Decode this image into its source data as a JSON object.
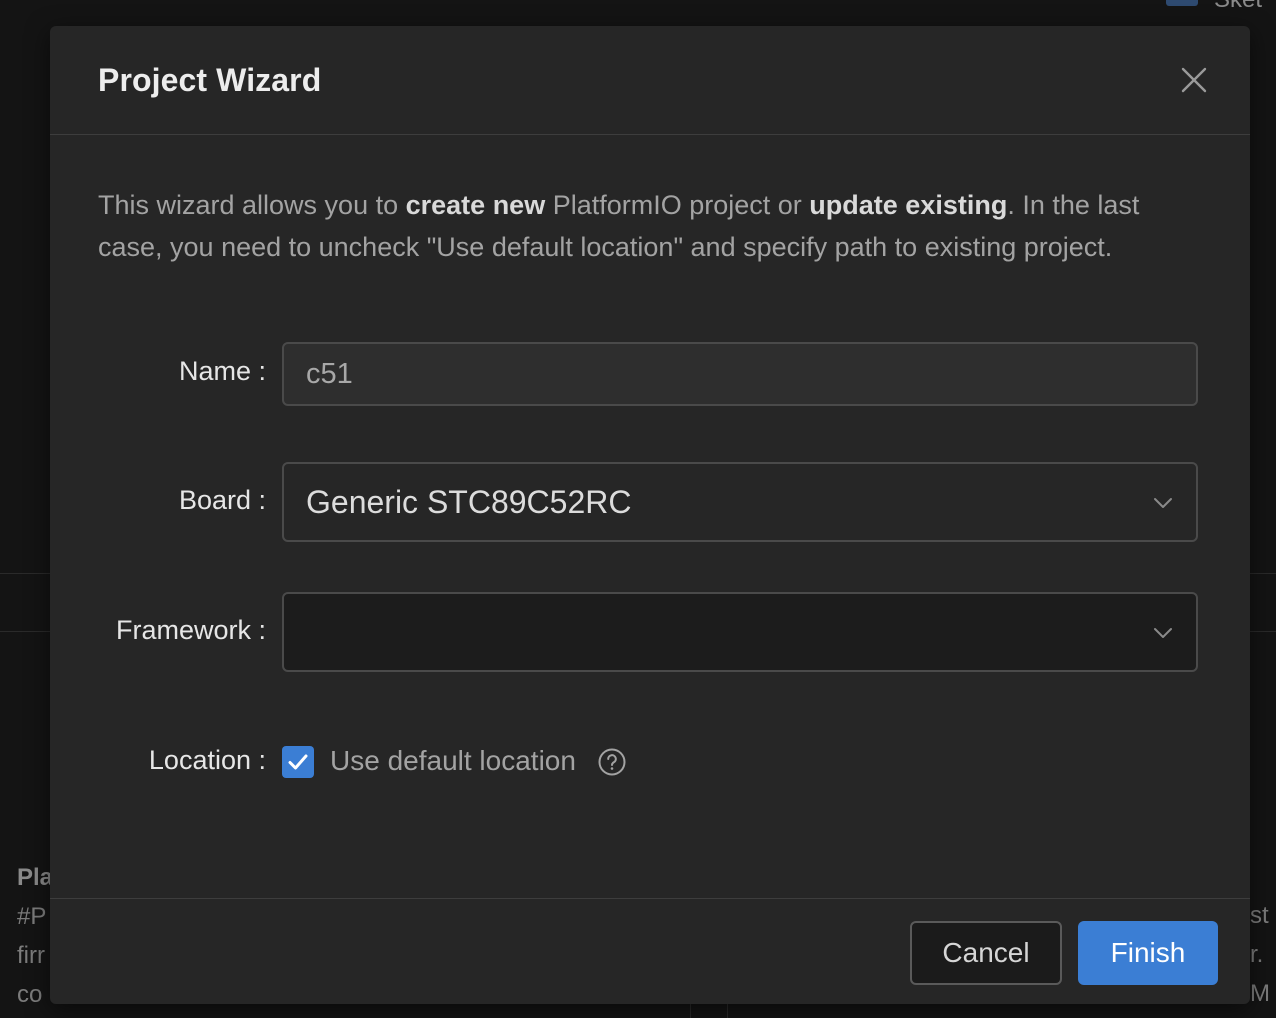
{
  "background": {
    "top_right_text": "Sket",
    "left_panel_lines": [
      "Pla",
      "#P",
      "firr",
      "co"
    ],
    "right_panel_lines": [
      "st",
      "r. M"
    ]
  },
  "dialog": {
    "title": "Project Wizard",
    "close_icon": "close-icon",
    "intro": {
      "part1": "This wizard allows you to ",
      "bold1": "create new",
      "part2": " PlatformIO project or ",
      "bold2": "update existing",
      "part3": ". In the last case, you need to uncheck \"Use default location\" and specify path to existing project."
    },
    "fields": {
      "name_label": "Name :",
      "name_value": "c51",
      "board_label": "Board :",
      "board_value": "Generic STC89C52RC",
      "framework_label": "Framework :",
      "framework_value": "",
      "location_label": "Location :",
      "location_checkbox_label": "Use default location",
      "location_checked": true
    },
    "buttons": {
      "cancel": "Cancel",
      "finish": "Finish"
    }
  },
  "colors": {
    "accent": "#3b7ed4",
    "modal_bg": "#262626",
    "backdrop": "#141414"
  }
}
